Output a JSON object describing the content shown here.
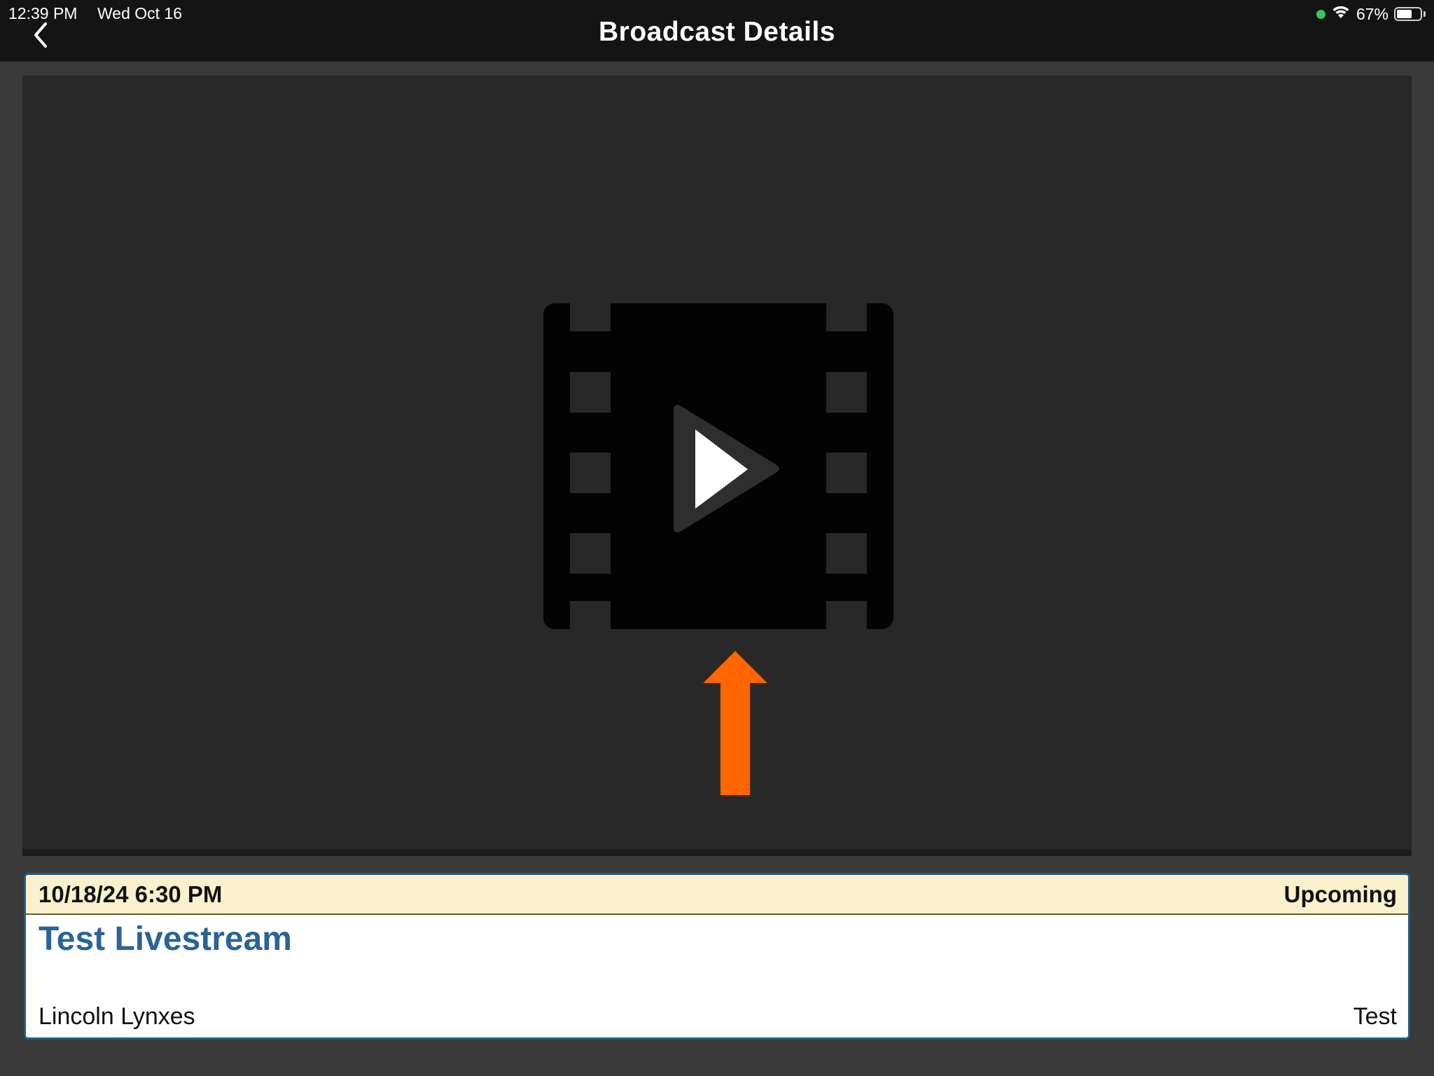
{
  "status_bar": {
    "time": "12:39 PM",
    "date": "Wed Oct 16",
    "battery": "67%",
    "battery_level": 0.67,
    "icons": [
      "green-dot-indicator",
      "wifi-icon",
      "battery-icon"
    ]
  },
  "header": {
    "title": "Broadcast Details",
    "back_icon": "chevron-left-icon"
  },
  "video": {
    "icon": "video-play-icon",
    "annotation": "up-arrow-icon",
    "annotation_color": "#ff6600"
  },
  "broadcast": {
    "datetime": "10/18/24 6:30 PM",
    "status": "Upcoming",
    "title": "Test Livestream",
    "team": "Lincoln Lynxes",
    "type": "Test",
    "title_color": "#2a6496",
    "header_bg": "#fbf0cc",
    "border_color": "#1f5f86"
  }
}
